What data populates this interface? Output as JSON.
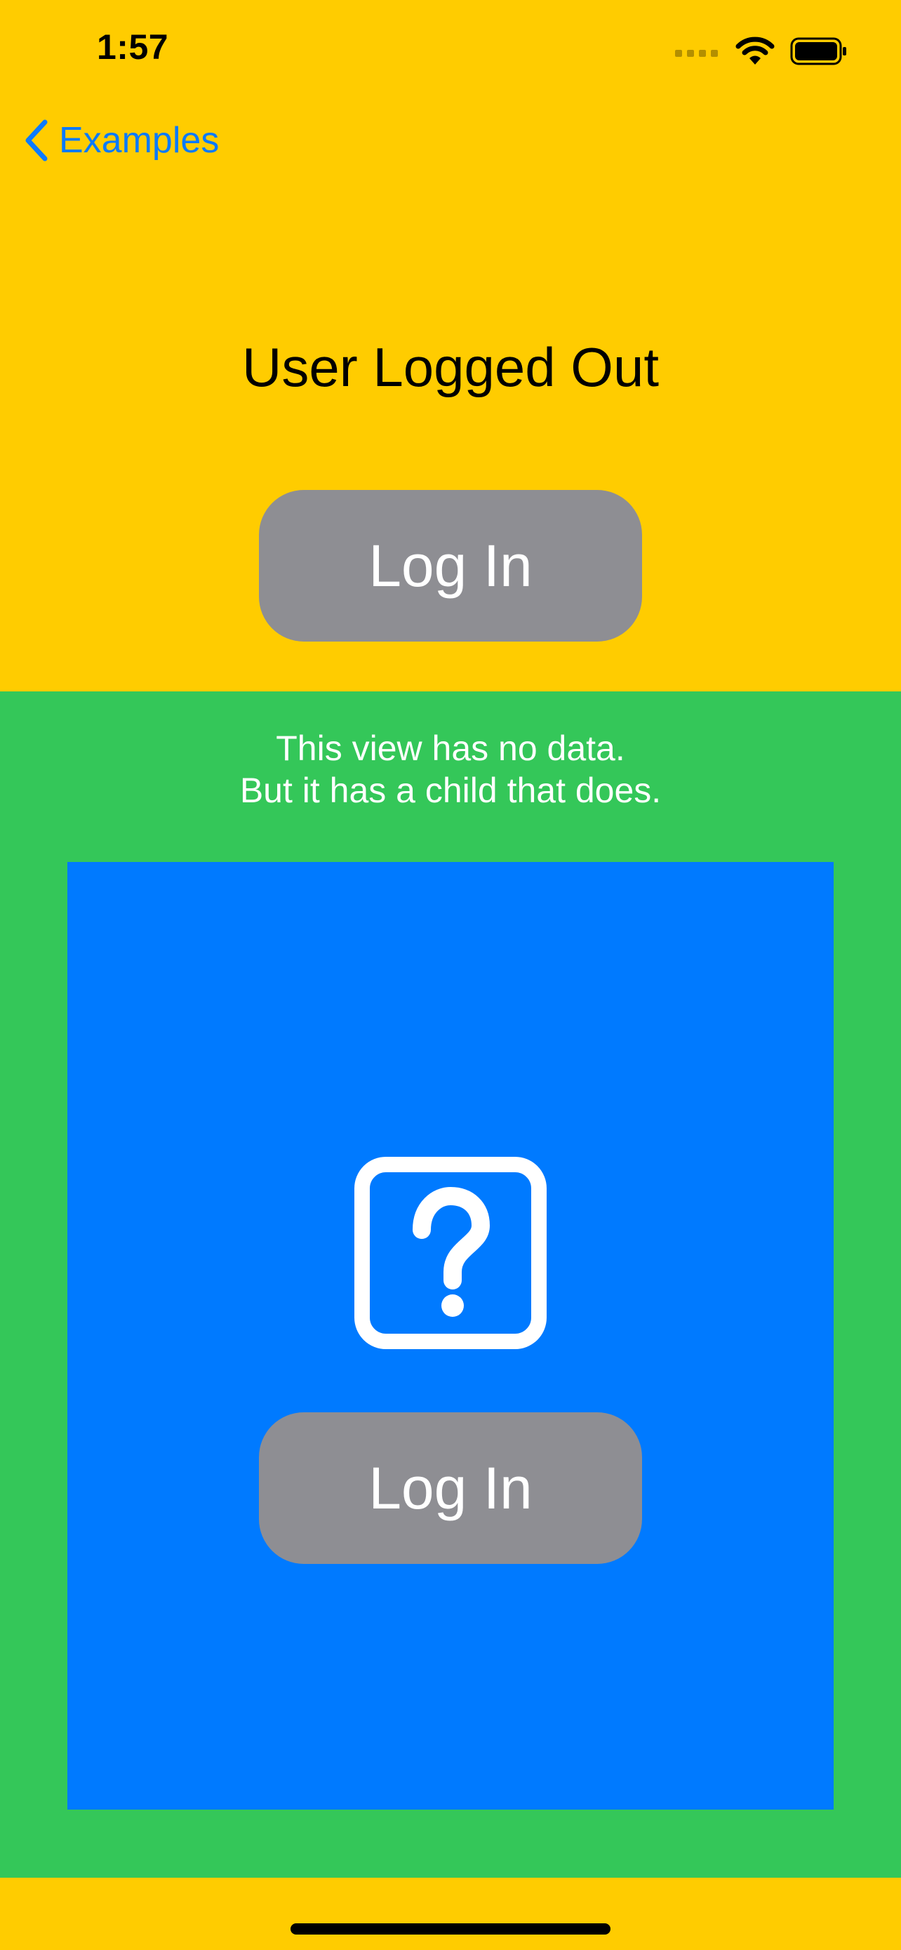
{
  "status_bar": {
    "time": "1:57"
  },
  "nav": {
    "back_label": "Examples"
  },
  "main": {
    "title": "User Logged Out",
    "login_button_label": "Log In"
  },
  "child_section": {
    "line1": "This view has no data.",
    "line2": "But it has a child that does.",
    "login_button_label": "Log In",
    "icon": "questionmark-square-icon"
  },
  "colors": {
    "yellow": "#FFCC00",
    "green": "#34C759",
    "blue": "#007AFF",
    "button_gray": "#8E8E93",
    "link_blue": "#0A7AFF"
  }
}
